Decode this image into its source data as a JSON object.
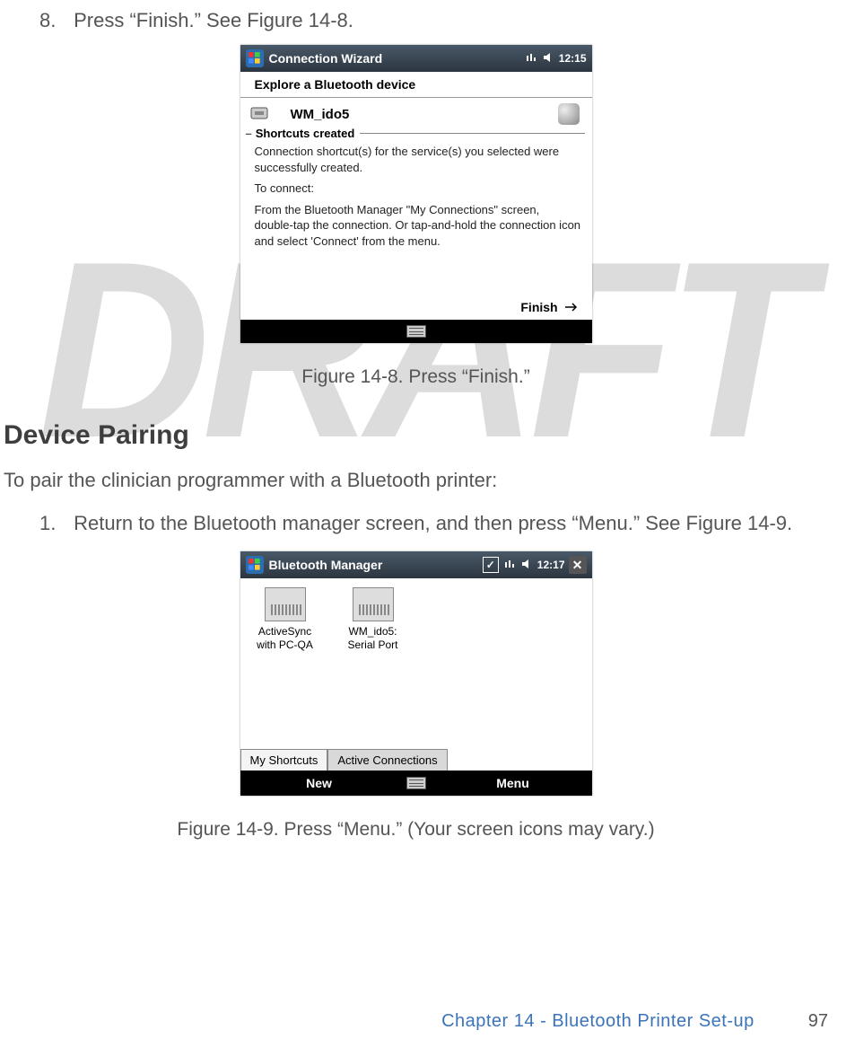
{
  "watermark": "DRAFT",
  "step8": {
    "num": "8.",
    "text": "Press “Finish.” See Figure 14-8."
  },
  "shot1": {
    "titlebar": {
      "title": "Connection Wizard",
      "time": "12:15"
    },
    "subhead": "Explore a Bluetooth device",
    "device": "WM_ido5",
    "group": "Shortcuts created",
    "p1": "Connection shortcut(s)  for the service(s) you selected were successfully created.",
    "p2": "To connect:",
    "p3": "From the Bluetooth Manager \"My Connections\" screen, double-tap the connection. Or tap-and-hold the connection icon and select 'Connect' from the menu.",
    "finish": "Finish"
  },
  "cap1": "Figure 14-8. Press “Finish.”",
  "section": "Device Pairing",
  "intro": "To pair the clinician programmer with a Bluetooth printer:",
  "step1": {
    "num": "1.",
    "text": "Return to the Bluetooth manager screen, and then press “Menu.” See Figure 14-9."
  },
  "shot2": {
    "titlebar": {
      "title": "Bluetooth Manager",
      "time": "12:17"
    },
    "items": [
      {
        "l1": "ActiveSync",
        "l2": "with PC-QA"
      },
      {
        "l1": "WM_ido5:",
        "l2": "Serial Port"
      }
    ],
    "tabs": {
      "a": "My Shortcuts",
      "b": "Active Connections"
    },
    "bottom": {
      "left": "New",
      "right": "Menu"
    }
  },
  "cap2": "Figure 14-9. Press “Menu.” (Your screen icons may vary.)",
  "footer": {
    "chapter": "Chapter 14 - Bluetooth Printer Set-up",
    "page": "97"
  }
}
